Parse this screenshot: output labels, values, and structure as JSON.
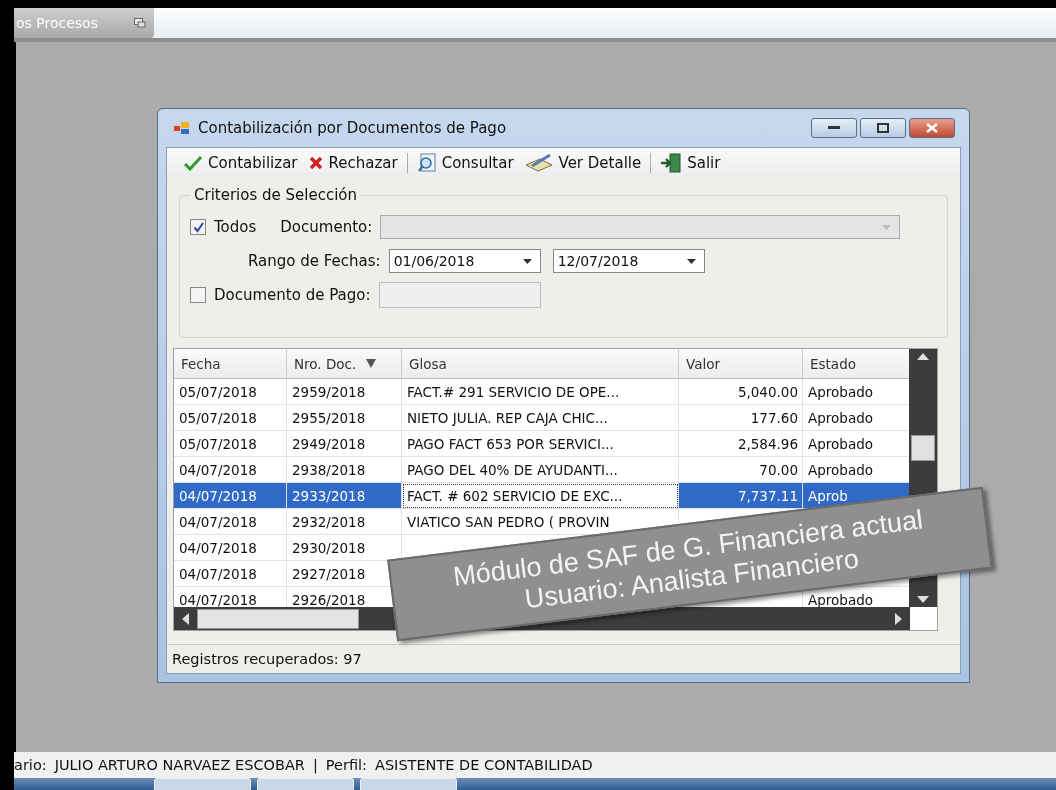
{
  "top_tab": {
    "label": "os Procesos"
  },
  "window": {
    "title": "Contabilización por Documentos de Pago"
  },
  "toolbar": [
    {
      "kind": "check",
      "label": "Contabilizar"
    },
    {
      "kind": "reject",
      "label": "Rechazar"
    },
    {
      "kind": "search",
      "label": "Consultar"
    },
    {
      "kind": "detail",
      "label": "Ver Detalle"
    },
    {
      "kind": "exit",
      "label": "Salir"
    }
  ],
  "criteria": {
    "title": "Criterios de Selección",
    "todos": {
      "label": "Todos",
      "checked": true
    },
    "documento": {
      "label": "Documento:",
      "disabled": true
    },
    "rango": {
      "label": "Rango de Fechas:",
      "from": "01/06/2018",
      "to": "12/07/2018"
    },
    "documento_pago": {
      "label": "Documento de Pago:",
      "checked": false
    }
  },
  "grid": {
    "columns": [
      {
        "label": "Fecha",
        "sorted": false
      },
      {
        "label": "Nro. Doc.",
        "sorted": true
      },
      {
        "label": "Glosa",
        "sorted": false
      },
      {
        "label": "Valor",
        "sorted": false
      },
      {
        "label": "Estado",
        "sorted": false
      }
    ],
    "rows": [
      {
        "fecha": "05/07/2018",
        "nro": "2959/2018",
        "glosa": "FACT.# 291 SERVICIO DE OPE...",
        "valor": "5,040.00",
        "estado": "Aprobado",
        "selected": false
      },
      {
        "fecha": "05/07/2018",
        "nro": "2955/2018",
        "glosa": "NIETO JULIA. REP CAJA CHIC...",
        "valor": "177.60",
        "estado": "Aprobado",
        "selected": false
      },
      {
        "fecha": "05/07/2018",
        "nro": "2949/2018",
        "glosa": "PAGO FACT 653 POR SERVICI...",
        "valor": "2,584.96",
        "estado": "Aprobado",
        "selected": false
      },
      {
        "fecha": "04/07/2018",
        "nro": "2938/2018",
        "glosa": "PAGO DEL 40% DE AYUDANTI...",
        "valor": "70.00",
        "estado": "Aprobado",
        "selected": false
      },
      {
        "fecha": "04/07/2018",
        "nro": "2933/2018",
        "glosa": "FACT. # 602 SERVICIO DE EXC...",
        "valor": "7,737.11",
        "estado": "Aprob",
        "selected": true
      },
      {
        "fecha": "04/07/2018",
        "nro": "2932/2018",
        "glosa": "VIATICO SAN PEDRO ( PROVIN",
        "selected": false
      },
      {
        "fecha": "04/07/2018",
        "nro": "2930/2018",
        "selected": false
      },
      {
        "fecha": "04/07/2018",
        "nro": "2927/2018",
        "selected": false
      },
      {
        "fecha": "04/07/2018",
        "nro": "2926/2018",
        "estado": "Aprobado",
        "selected": false
      }
    ]
  },
  "window_status": "Registros recuperados: 97",
  "annotation": {
    "lines": [
      "Módulo de SAF de G. Financiera actual",
      "Usuario: Analista Financiero"
    ]
  },
  "status_bar": [
    {
      "label": "ario:",
      "value": "JULIO ARTURO NARVAEZ ESCOBAR"
    },
    {
      "label": "Perfil:",
      "value": "ASISTENTE DE CONTABILIDAD"
    }
  ],
  "separator": "|"
}
